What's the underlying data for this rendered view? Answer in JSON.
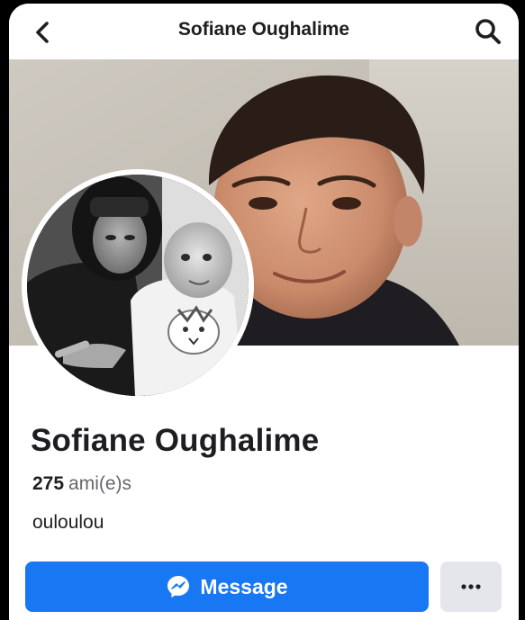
{
  "header": {
    "title": "Sofiane Oughalime",
    "back_icon": "chevron-left-icon",
    "search_icon": "search-icon"
  },
  "profile": {
    "name": "Sofiane Oughalime",
    "friends_count": "275",
    "friends_label": "ami(e)s",
    "bio": "ouloulou"
  },
  "actions": {
    "message_label": "Message",
    "message_icon": "messenger-icon",
    "more_icon": "more-dots-icon"
  },
  "colors": {
    "primary": "#1877f2",
    "secondary_button": "#e4e6eb",
    "text": "#1c1e21",
    "muted_text": "#65676b"
  }
}
